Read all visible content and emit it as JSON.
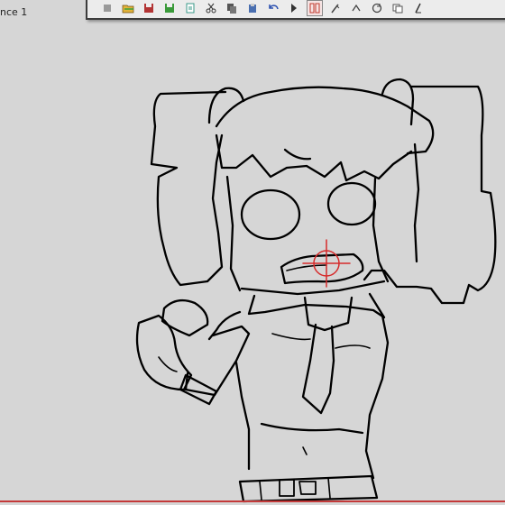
{
  "scene": {
    "label": "nce 1"
  },
  "toolbar": {
    "buttons": [
      {
        "name": "stop-icon"
      },
      {
        "name": "open-folder-icon"
      },
      {
        "name": "save-icon"
      },
      {
        "name": "save-green-icon"
      },
      {
        "name": "export-icon"
      },
      {
        "name": "scissors-icon"
      },
      {
        "name": "copy-icon"
      },
      {
        "name": "paste-icon"
      },
      {
        "name": "undo-icon"
      },
      {
        "name": "redo-icon"
      },
      {
        "name": "onion-skin-icon"
      },
      {
        "name": "brush-icon"
      },
      {
        "name": "rotate-icon"
      },
      {
        "name": "refresh-icon"
      },
      {
        "name": "layers-icon"
      },
      {
        "name": "pen-icon"
      }
    ],
    "colors": {
      "accent_red": "#c0392b",
      "toolbar_bg": "#ececec",
      "border": "#3c3c3c"
    }
  },
  "canvas": {
    "background": "#d6d6d6",
    "crosshair_color": "#d62a2a",
    "stroke_color": "#000000"
  }
}
